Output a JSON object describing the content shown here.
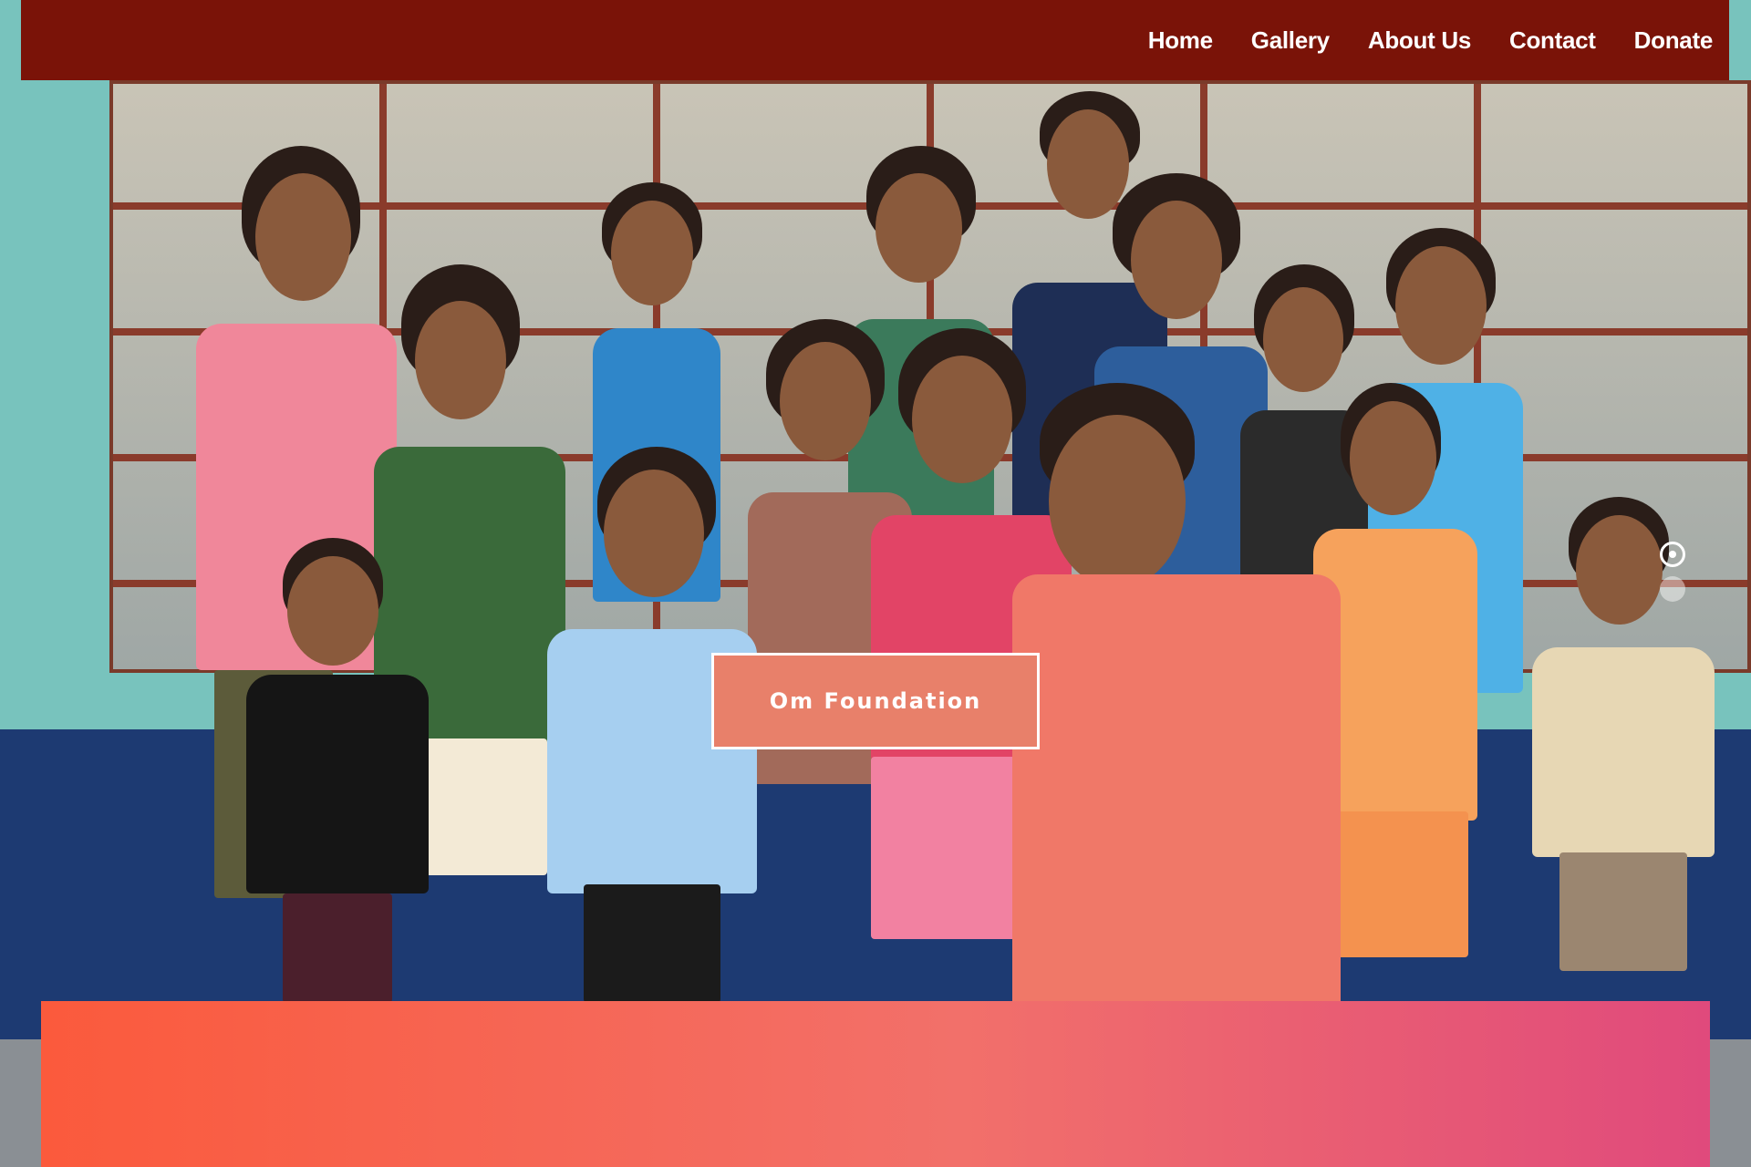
{
  "nav": {
    "links": [
      {
        "label": "Home"
      },
      {
        "label": "Gallery"
      },
      {
        "label": "About Us"
      },
      {
        "label": "Contact"
      },
      {
        "label": "Donate"
      }
    ]
  },
  "hero": {
    "cta_label": "Om Foundation",
    "slider": {
      "active_index": 0,
      "count": 2
    }
  },
  "colors": {
    "navbar": "#7a1308",
    "cta": "#e8806a",
    "gradient_start": "#fb5a3c",
    "gradient_end": "#e04a7c"
  }
}
